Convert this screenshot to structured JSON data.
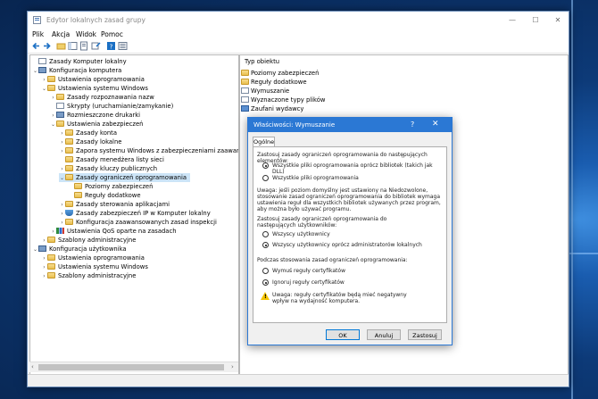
{
  "window": {
    "title": "Edytor lokalnych zasad grupy",
    "controls": {
      "minimize": "—",
      "maximize": "☐",
      "close": "✕"
    }
  },
  "menu": [
    "Plik",
    "Akcja",
    "Widok",
    "Pomoc"
  ],
  "toolbar_icons": [
    "back-icon",
    "forward-icon",
    "up-folder-icon",
    "show-tree-icon",
    "export-icon",
    "properties-icon",
    "help-icon",
    "view-icon"
  ],
  "tree": [
    {
      "label": "Zasady Komputer lokalny",
      "icon": "doc",
      "level": 0,
      "chevron": ""
    },
    {
      "label": "Konfiguracja komputera",
      "icon": "pc",
      "level": 0,
      "chevron": "⌄"
    },
    {
      "label": "Ustawienia oprogramowania",
      "icon": "folder",
      "level": 1,
      "chevron": "›"
    },
    {
      "label": "Ustawienia systemu Windows",
      "icon": "folder",
      "level": 1,
      "chevron": "⌄"
    },
    {
      "label": "Zasady rozpoznawania nazw",
      "icon": "folder",
      "level": 2,
      "chevron": "›"
    },
    {
      "label": "Skrypty (uruchamianie/zamykanie)",
      "icon": "doc",
      "level": 2,
      "chevron": ""
    },
    {
      "label": "Rozmieszczone drukarki",
      "icon": "pc",
      "level": 2,
      "chevron": "›"
    },
    {
      "label": "Ustawienia zabezpieczeń",
      "icon": "folder",
      "level": 2,
      "chevron": "⌄"
    },
    {
      "label": "Zasady konta",
      "icon": "folder",
      "level": 3,
      "chevron": "›"
    },
    {
      "label": "Zasady lokalne",
      "icon": "folder",
      "level": 3,
      "chevron": "›"
    },
    {
      "label": "Zapora systemu Windows z zabezpieczeniami zaawansowanymi",
      "icon": "folder",
      "level": 3,
      "chevron": "›"
    },
    {
      "label": "Zasady menedżera listy sieci",
      "icon": "folder",
      "level": 3,
      "chevron": ""
    },
    {
      "label": "Zasady kluczy publicznych",
      "icon": "folder",
      "level": 3,
      "chevron": "›"
    },
    {
      "label": "Zasady ograniczeń oprogramowania",
      "icon": "folder",
      "level": 3,
      "chevron": "⌄",
      "selected": true
    },
    {
      "label": "Poziomy zabezpieczeń",
      "icon": "folder",
      "level": 4,
      "chevron": ""
    },
    {
      "label": "Reguły dodatkowe",
      "icon": "folder",
      "level": 4,
      "chevron": ""
    },
    {
      "label": "Zasady sterowania aplikacjami",
      "icon": "folder",
      "level": 3,
      "chevron": "›"
    },
    {
      "label": "Zasady zabezpieczeń IP w Komputer lokalny",
      "icon": "shield",
      "level": 3,
      "chevron": "›"
    },
    {
      "label": "Konfiguracja zaawansowanych zasad inspekcji",
      "icon": "folder",
      "level": 3,
      "chevron": "›"
    },
    {
      "label": "Ustawienia QoS oparte na zasadach",
      "icon": "chart",
      "level": 2,
      "chevron": "›"
    },
    {
      "label": "Szablony administracyjne",
      "icon": "folder",
      "level": 1,
      "chevron": "›"
    },
    {
      "label": "Konfiguracja użytkownika",
      "icon": "pc",
      "level": 0,
      "chevron": "⌄"
    },
    {
      "label": "Ustawienia oprogramowania",
      "icon": "folder",
      "level": 1,
      "chevron": "›"
    },
    {
      "label": "Ustawienia systemu Windows",
      "icon": "folder",
      "level": 1,
      "chevron": "›"
    },
    {
      "label": "Szablony administracyjne",
      "icon": "folder",
      "level": 1,
      "chevron": "›"
    }
  ],
  "right_pane": {
    "header": "Typ obiektu",
    "items": [
      {
        "label": "Poziomy zabezpieczeń",
        "icon": "folder"
      },
      {
        "label": "Reguły dodatkowe",
        "icon": "folder"
      },
      {
        "label": "Wymuszanie",
        "icon": "doc"
      },
      {
        "label": "Wyznaczone typy plików",
        "icon": "doc"
      },
      {
        "label": "Zaufani wydawcy",
        "icon": "book"
      }
    ]
  },
  "dialog": {
    "title": "Właściwości: Wymuszanie",
    "help": "?",
    "close": "✕",
    "tab": "Ogólne",
    "section1": "Zastosuj zasady ograniczeń oprogramowania do następujących elementów:",
    "radio1a": "Wszystkie pliki oprogramowania oprócz bibliotek (takich jak DLL)",
    "radio1b": "Wszystkie pliki oprogramowania",
    "note1": "Uwaga: jeśli poziom domyślny jest ustawiony na Niedozwolone, stosowanie zasad ograniczeń oprogramowania do bibliotek wymaga ustawienia reguł dla wszystkich bibliotek używanych przez program, aby można było używać programu.",
    "section2": "Zastosuj zasady ograniczeń oprogramowania do następujących użytkowników:",
    "radio2a": "Wszyscy użytkownicy",
    "radio2b": "Wszyscy użytkownicy oprócz administratorów lokalnych",
    "section3": "Podczas stosowania zasad ograniczeń oprogramowania:",
    "radio3a": "Wymuś reguły certyfikatów",
    "radio3b": "Ignoruj reguły certyfikatów",
    "warning": "Uwaga: reguły certyfikatów będą mieć negatywny wpływ na wydajność komputera.",
    "buttons": {
      "ok": "OK",
      "cancel": "Anuluj",
      "apply": "Zastosuj"
    }
  }
}
